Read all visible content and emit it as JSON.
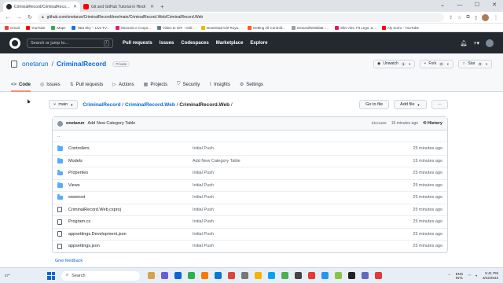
{
  "browser": {
    "tabs": [
      {
        "title": "CriminalRecord/CriminalRecord.W",
        "icon_color": "#24292f",
        "active": true
      },
      {
        "title": "Git and GitHub Tutorial in Hindi",
        "icon_color": "#ff0000",
        "active": false
      }
    ],
    "url": "github.com/onetarun/CriminalRecord/tree/main/CriminalRecord.Web/CriminalRecord.Web",
    "bookmarks": [
      {
        "label": "Gmail",
        "color": "#ea4335"
      },
      {
        "label": "YouTube",
        "color": "#ff0000"
      },
      {
        "label": "Maps",
        "color": "#34a853"
      },
      {
        "label": "Tata Sky – Live TV...",
        "color": "#1a73e8"
      },
      {
        "label": "Musculo e Corpo...",
        "color": "#e91e63"
      },
      {
        "label": "Video to GIF - Onli...",
        "color": "#607d8b"
      },
      {
        "label": "Download Girl Roya...",
        "color": "#f4b400"
      },
      {
        "label": "Getting All Controll...",
        "color": "#ff5722"
      },
      {
        "label": "Gesundheitsblatt -...",
        "color": "#9e9e9e"
      },
      {
        "label": "Slim Abs, Fit Legs, a...",
        "color": "#d81b60"
      },
      {
        "label": "Aly Sorro - YouTube",
        "color": "#ff0000"
      }
    ]
  },
  "github": {
    "search_placeholder": "Search or jump to...",
    "search_key": "/",
    "nav": [
      "Pull requests",
      "Issues",
      "Codespaces",
      "Marketplace",
      "Explore"
    ]
  },
  "repo": {
    "owner": "onetarun",
    "name": "CriminalRecord",
    "visibility": "Private",
    "unwatch_label": "Unwatch",
    "unwatch_count": "1",
    "fork_label": "Fork",
    "fork_count": "0",
    "star_label": "Star",
    "star_count": "0",
    "tabs": [
      {
        "label": "Code",
        "icon": "<>"
      },
      {
        "label": "Issues",
        "icon": "◎"
      },
      {
        "label": "Pull requests",
        "icon": "⇅"
      },
      {
        "label": "Actions",
        "icon": "▷"
      },
      {
        "label": "Projects",
        "icon": "▦"
      },
      {
        "label": "Security",
        "icon": "⛉"
      },
      {
        "label": "Insights",
        "icon": "⌇"
      },
      {
        "label": "Settings",
        "icon": "⚙"
      }
    ]
  },
  "path": {
    "branch": "main",
    "crumb_root": "CriminalRecord",
    "crumb_mid": "CriminalRecord.Web",
    "crumb_current": "CriminalRecord.Web",
    "goto_file": "Go to file",
    "add_file": "Add file",
    "more": "···"
  },
  "commit": {
    "author": "onetarun",
    "message": "Add New Category Table",
    "hash": "bb21a98",
    "age": "15 minutes ago",
    "history": "History"
  },
  "files": [
    {
      "type": "dir",
      "name": "Controllers",
      "commit": "Initial Push",
      "age": "25 minutes ago"
    },
    {
      "type": "dir",
      "name": "Models",
      "commit": "Add New Category Table",
      "age": "15 minutes ago"
    },
    {
      "type": "dir",
      "name": "Properties",
      "commit": "Initial Push",
      "age": "25 minutes ago"
    },
    {
      "type": "dir",
      "name": "Views",
      "commit": "Initial Push",
      "age": "25 minutes ago"
    },
    {
      "type": "dir",
      "name": "wwwroot",
      "commit": "Initial Push",
      "age": "25 minutes ago"
    },
    {
      "type": "file",
      "name": "CriminalRecord.Web.csproj",
      "commit": "Initial Push",
      "age": "25 minutes ago"
    },
    {
      "type": "file",
      "name": "Program.cs",
      "commit": "Initial Push",
      "age": "25 minutes ago"
    },
    {
      "type": "file",
      "name": "appsettings.Development.json",
      "commit": "Initial Push",
      "age": "25 minutes ago"
    },
    {
      "type": "file",
      "name": "appsettings.json",
      "commit": "Initial Push",
      "age": "25 minutes ago"
    }
  ],
  "parent_dir": "..",
  "feedback": "Give feedback",
  "taskbar": {
    "weather": "27°",
    "search": "Search",
    "lang": "ENG",
    "region": "INTL",
    "time": "5:41 PM",
    "date": "3/22/2023",
    "app_colors": [
      "#d8a24a",
      "#6b5bd6",
      "#0a64d8",
      "#2bb24c",
      "#f57c00",
      "#0078d4",
      "#db4437",
      "#777",
      "#f5b400",
      "#00a4ef",
      "#4caf50",
      "#444",
      "#e53935",
      "#2196f3",
      "#8bc34a",
      "#222",
      "#5c6bc0",
      "#e53935"
    ]
  }
}
